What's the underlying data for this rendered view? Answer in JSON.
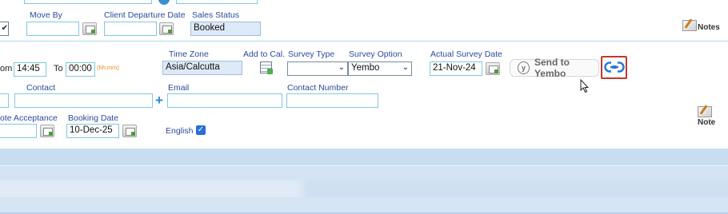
{
  "top_row": {
    "partial_value_1": "...",
    "partial_value_2": "...",
    "move_by_label": "Move By",
    "client_departure_label": "Client Departure Date",
    "sales_status_label": "Sales Status",
    "sales_status_value": "Booked",
    "notes_label": "Notes"
  },
  "survey_row": {
    "from_label_partial": "om",
    "from_time": "14:45",
    "to_label": "To",
    "to_time": "00:00",
    "time_hint": "(hh:mm)",
    "time_zone_label": "Time Zone",
    "time_zone_value": "Asia/Calcutta",
    "add_to_cal_label": "Add to Cal.",
    "survey_type_label": "Survey Type",
    "survey_type_value": "",
    "survey_option_label": "Survey Option",
    "survey_option_value": "Yembo",
    "actual_survey_date_label": "Actual Survey Date",
    "actual_survey_date_value": "21-Nov-24",
    "send_to_yembo_label": "Send to Yembo"
  },
  "contact_row": {
    "contact_label": "Contact",
    "email_label": "Email",
    "contact_number_label": "Contact Number",
    "notes_label": "Note"
  },
  "booking_row": {
    "quote_acceptance_label": "ote Acceptance",
    "booking_date_label": "Booking Date",
    "booking_date_value": "10-Dec-25",
    "language_label": "English",
    "language_checked": true
  },
  "colors": {
    "label_blue": "#2a4aa0",
    "field_border": "#7fc8e0",
    "highlight_red": "#c0392b",
    "band_blue": "#cfe0f2"
  }
}
